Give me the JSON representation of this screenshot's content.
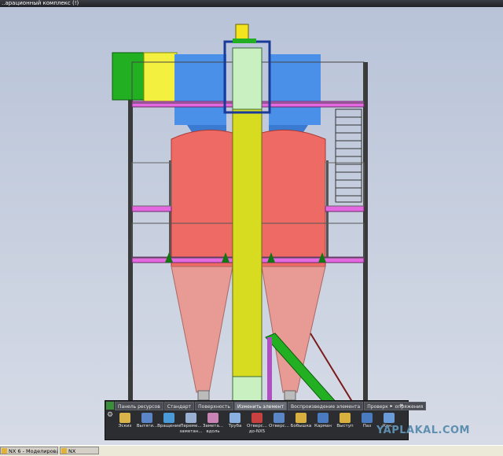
{
  "window": {
    "title": "..арационный комплекс (!)"
  },
  "toolbar": {
    "tabs": [
      {
        "label": "Панель ресурсов"
      },
      {
        "label": "Стандарт"
      },
      {
        "label": "Поверхность"
      },
      {
        "label": "Изменить элемент"
      },
      {
        "label": "Воспроизведение элемента"
      },
      {
        "label": "Проверка сопряжения"
      }
    ],
    "tools": [
      {
        "label": "Эскиз",
        "icon": "sketch-icon",
        "color": "#d9b44a"
      },
      {
        "label": "Вытяги...",
        "icon": "extrude-icon",
        "color": "#5a86c8"
      },
      {
        "label": "Вращение",
        "icon": "revolve-icon",
        "color": "#4a9ad8"
      },
      {
        "label": "Переме... заметан...",
        "icon": "sweep-icon",
        "color": "#9ab0d0"
      },
      {
        "label": "Замета... вдоль",
        "icon": "sweep-along-icon",
        "color": "#c884b4"
      },
      {
        "label": "Труба",
        "icon": "tube-icon",
        "color": "#8ab0e0"
      },
      {
        "label": "Отверс... до-NX5",
        "icon": "hole-nx5-icon",
        "color": "#c84040"
      },
      {
        "label": "Отверс...",
        "icon": "hole-icon",
        "color": "#5a86c8"
      },
      {
        "label": "Бобышка",
        "icon": "boss-icon",
        "color": "#d8b040"
      },
      {
        "label": "Карман",
        "icon": "pocket-icon",
        "color": "#4a7ac0"
      },
      {
        "label": "Выступ",
        "icon": "pad-icon",
        "color": "#d8b040"
      },
      {
        "label": "Паз",
        "icon": "slot-icon",
        "color": "#4a7ac0"
      },
      {
        "label": "Кан...",
        "icon": "groove-icon",
        "color": "#6a9ad8"
      }
    ]
  },
  "taskbar": {
    "items": [
      {
        "label": "NX 6 - Моделирован..."
      },
      {
        "label": "NX"
      }
    ]
  },
  "watermark": "YAPLAKAL.COM",
  "colors": {
    "viewport_bg": "#c9d1e0",
    "cyclone_body": "#ee6a64",
    "cone": "#e89a94",
    "tank": "#4a8fe8",
    "elevator": "#d8dc20",
    "platform": "#e468e0",
    "frame": "#3a3a3a",
    "accent_green": "#1fa81f"
  }
}
